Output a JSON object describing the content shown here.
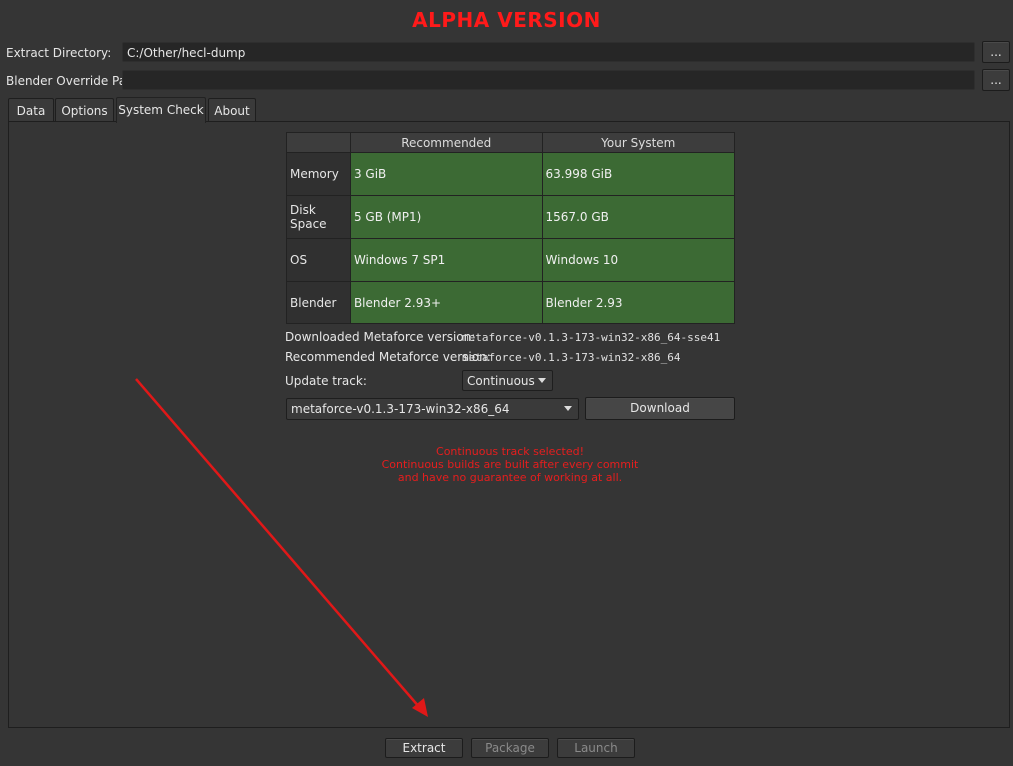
{
  "banner": "ALPHA VERSION",
  "extract_dir": {
    "label": "Extract Directory:",
    "value": "C:/Other/hecl-dump",
    "browse": "..."
  },
  "blender_override": {
    "label": "Blender Override Path:",
    "value": "",
    "browse": "..."
  },
  "tabs": [
    {
      "label": "Data",
      "active": false
    },
    {
      "label": "Options",
      "active": false
    },
    {
      "label": "System Check",
      "active": true
    },
    {
      "label": "About",
      "active": false
    }
  ],
  "system_table": {
    "headers": [
      "Recommended",
      "Your System"
    ],
    "rows": [
      {
        "name": "Memory",
        "recommended": "3 GiB",
        "yours": "63.998 GiB"
      },
      {
        "name": "Disk Space",
        "recommended": "5 GB (MP1)",
        "yours": "1567.0 GB"
      },
      {
        "name": "OS",
        "recommended": "Windows 7 SP1",
        "yours": "Windows 10"
      },
      {
        "name": "Blender",
        "recommended": "Blender 2.93+",
        "yours": "Blender 2.93"
      }
    ],
    "ok_color": "#3c6a34"
  },
  "versions": {
    "downloaded_label": "Downloaded Metaforce version:",
    "downloaded_value": "metaforce-v0.1.3-173-win32-x86_64-sse41",
    "recommended_label": "Recommended Metaforce version:",
    "recommended_value": "metaforce-v0.1.3-173-win32-x86_64",
    "track_label": "Update track:",
    "track_value": "Continuous",
    "selected_build": "metaforce-v0.1.3-173-win32-x86_64",
    "download_button": "Download"
  },
  "warning": {
    "lines": [
      "Continuous track selected!",
      "Continuous builds are built after every commit",
      "and have no guarantee of working at all."
    ],
    "color": "#e61e1e"
  },
  "footer": {
    "extract": "Extract",
    "package": "Package",
    "launch": "Launch"
  },
  "colors": {
    "banner": "#ff1a1a",
    "annotation_arrow": "#e01818"
  }
}
